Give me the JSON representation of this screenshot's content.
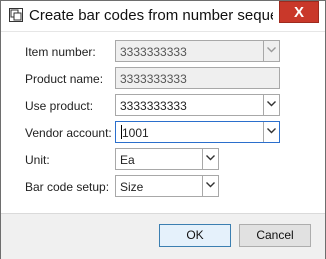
{
  "window": {
    "title": "Create bar codes from number seque...",
    "close_glyph": "X"
  },
  "form": {
    "item_number": {
      "label": "Item number:",
      "value": "3333333333"
    },
    "product_name": {
      "label": "Product name:",
      "value": "3333333333"
    },
    "use_product": {
      "label": "Use product:",
      "value": "3333333333"
    },
    "vendor_account": {
      "label": "Vendor account:",
      "value": "1001"
    },
    "unit": {
      "label": "Unit:",
      "value": "Ea"
    },
    "bar_code_setup": {
      "label": "Bar code setup:",
      "value": "Size"
    }
  },
  "footer": {
    "ok_label": "OK",
    "cancel_label": "Cancel"
  },
  "icons": {
    "app": "app-window-icon",
    "dropdown": "chevron-down-icon"
  },
  "colors": {
    "close_button": "#c9382a",
    "focus_border": "#2b6fcc",
    "ok_border": "#3c7fb1",
    "readonly_bg": "#efefef"
  }
}
